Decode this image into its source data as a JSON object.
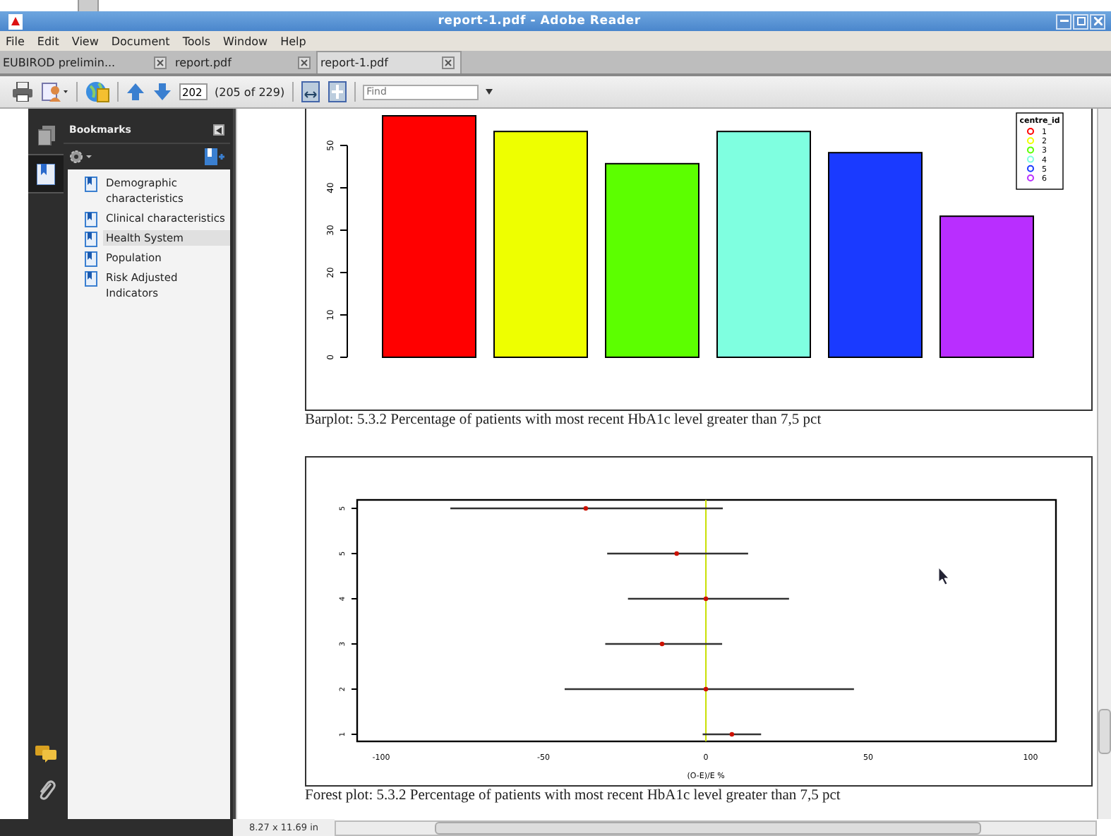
{
  "window": {
    "title": "report-1.pdf - Adobe Reader"
  },
  "menu": [
    "File",
    "Edit",
    "View",
    "Document",
    "Tools",
    "Window",
    "Help"
  ],
  "tabs": [
    {
      "label": "EUBIROD prelimin...",
      "selected": false
    },
    {
      "label": "report.pdf",
      "selected": false
    },
    {
      "label": "report-1.pdf",
      "selected": true
    }
  ],
  "toolbar": {
    "page_number": "202",
    "page_count": "(205 of 229)",
    "find": {
      "placeholder": "Find"
    }
  },
  "bookmarks": {
    "title": "Bookmarks",
    "items": [
      {
        "label": "Demographic characteristics",
        "selected": false
      },
      {
        "label": "Clinical characteristics",
        "selected": false
      },
      {
        "label": "Health System",
        "selected": true
      },
      {
        "label": "Population",
        "selected": false
      },
      {
        "label": "Risk Adjusted Indicators",
        "selected": false
      }
    ]
  },
  "barplot": {
    "caption": "Barplot: 5.3.2 Percentage of patients with most recent HbA1c level greater than 7,5 pct",
    "chart_data": {
      "type": "bar",
      "legend": {
        "title": "centre_id"
      },
      "ylim": [
        0,
        57
      ],
      "yticks": [
        0,
        10,
        20,
        30,
        40,
        50
      ],
      "series": [
        {
          "name": "1",
          "color": "#ff0000",
          "values": [
            57
          ]
        },
        {
          "name": "2",
          "color": "#eeff00",
          "values": [
            53.3
          ]
        },
        {
          "name": "3",
          "color": "#5cff00",
          "values": [
            45.7
          ]
        },
        {
          "name": "4",
          "color": "#7fffe0",
          "values": [
            53.3
          ]
        },
        {
          "name": "5",
          "color": "#1a3aff",
          "values": [
            48.3
          ]
        },
        {
          "name": "6",
          "color": "#b92eff",
          "values": [
            33.3
          ]
        }
      ]
    }
  },
  "forestplot": {
    "caption": "Forest plot: 5.3.2 Percentage of patients with most recent HbA1c level greater than 7,5 pct",
    "chart_data": {
      "type": "scatter",
      "orientation": "horizontal",
      "xlabel": "(O-E)/E %",
      "xlim": [
        -107.4,
        107.8
      ],
      "xticks": [
        -100,
        -50,
        0,
        50,
        100
      ],
      "ref_lines": [
        {
          "axis": "x",
          "value": 0,
          "color": "#c8e000"
        }
      ],
      "categories": [
        "5",
        "5",
        "4",
        "3",
        "2",
        "1"
      ],
      "series": [
        {
          "color": "#cc1100",
          "values": [
            -37,
            -9,
            0,
            -13.5,
            0,
            8
          ],
          "errors": [
            [
              -78.7,
              5.2
            ],
            [
              -30.4,
              13
            ],
            [
              -24,
              25.6
            ],
            [
              -31,
              5
            ],
            [
              -43.5,
              45.6
            ],
            [
              -1,
              17
            ]
          ]
        }
      ]
    }
  },
  "status_bar": {
    "page_size": "8.27 x 11.69 in"
  }
}
